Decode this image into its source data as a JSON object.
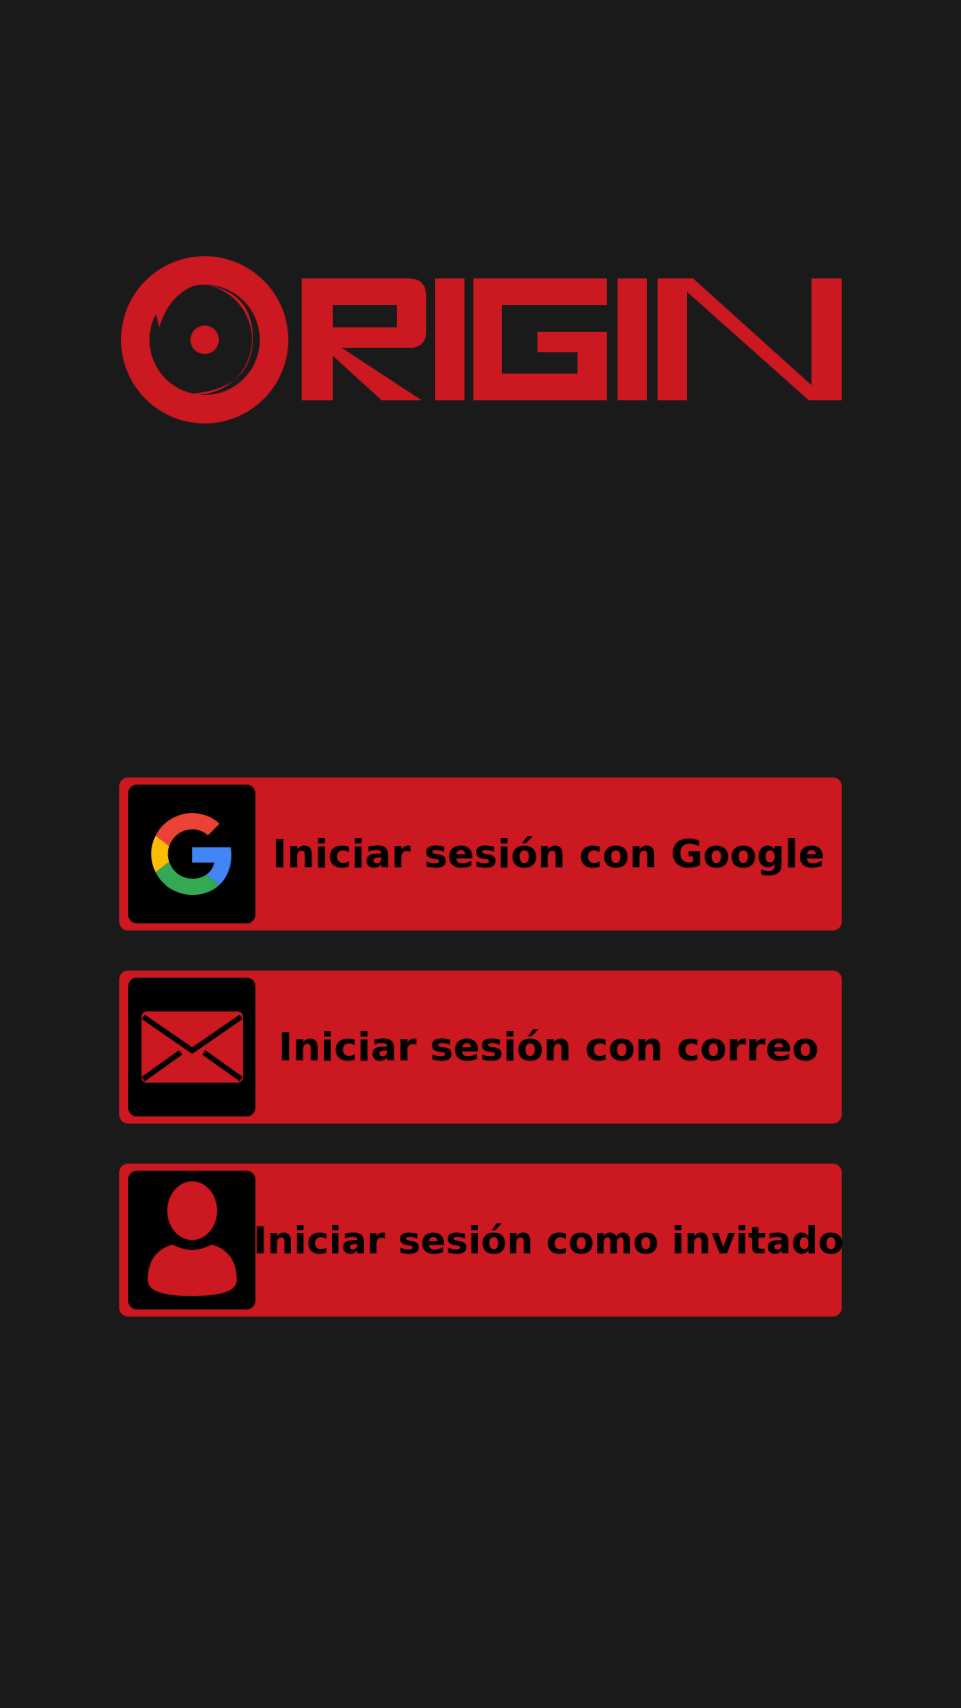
{
  "brand": {
    "name": "ORIGIN",
    "accent_color": "#cc1820",
    "background_color": "#1a1a1a"
  },
  "buttons": [
    {
      "id": "google",
      "label": "Iniciar sesión con Google",
      "icon": "google-icon"
    },
    {
      "id": "email",
      "label": "Iniciar sesión con correo",
      "icon": "envelope-icon"
    },
    {
      "id": "guest",
      "label": "Iniciar sesión como invitado",
      "icon": "user-icon"
    }
  ]
}
